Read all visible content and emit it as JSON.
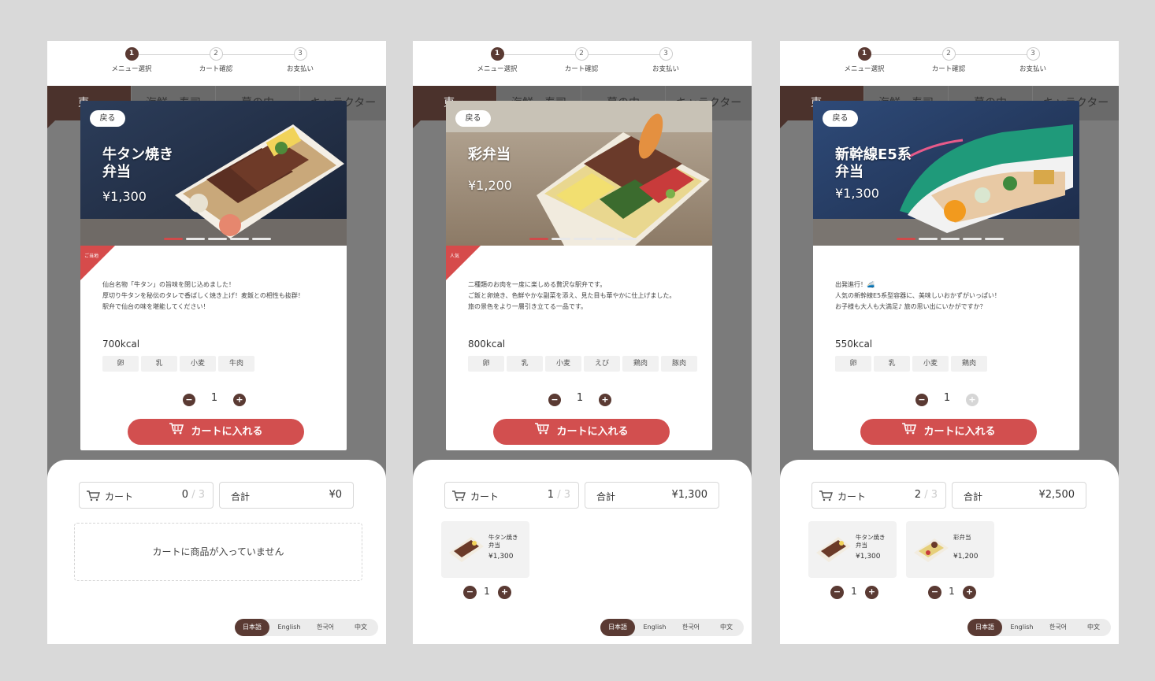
{
  "steps": [
    "メニュー選択",
    "カート確認",
    "お支払い"
  ],
  "step_numbers": [
    "1",
    "2",
    "3"
  ],
  "tabs": [
    "東…",
    "海鮮・寿司",
    "幕の内",
    "キャラクター"
  ],
  "back_label": "戻る",
  "cart_button_label": "カートに入れる",
  "cart_label": "カート",
  "total_label": "合計",
  "cart_max": "3",
  "empty_cart_message": "カートに商品が入っていません",
  "languages": [
    "日本語",
    "English",
    "한국어",
    "中文"
  ],
  "colors": {
    "brand_brown": "#5a3a33",
    "accent_red": "#d24f4f",
    "overlay_gray": "#7b7b7b"
  },
  "screens": [
    {
      "product": {
        "name_line1": "牛タン焼き",
        "name_line2": "弁当",
        "price": "¥1,300",
        "badge": "ご当地",
        "description": [
          "仙台名物「牛タン」の旨味を閉じ込めました！",
          "厚切り牛タンを秘伝のタレで香ばしく焼き上げ！麦飯との相性も抜群！",
          "駅弁で仙台の味を堪能してください！"
        ],
        "kcal": "700kcal",
        "allergens": [
          "卵",
          "乳",
          "小麦",
          "牛肉"
        ],
        "quantity": "1",
        "plus_enabled": true
      },
      "cart": {
        "count": "0",
        "total": "¥0",
        "items": []
      }
    },
    {
      "product": {
        "name_line1": "彩弁当",
        "name_line2": "",
        "price": "¥1,200",
        "badge": "人気",
        "description": [
          "二種類のお肉を一度に楽しめる贅沢な駅弁です。",
          "ご飯と卵焼き、色鮮やかな副菜を添え、見た目も華やかに仕上げました。",
          "旅の景色をより一層引き立てる一品です。"
        ],
        "kcal": "800kcal",
        "allergens": [
          "卵",
          "乳",
          "小麦",
          "えび",
          "鶏肉",
          "豚肉"
        ],
        "quantity": "1",
        "plus_enabled": true
      },
      "cart": {
        "count": "1",
        "total": "¥1,300",
        "items": [
          {
            "name_line1": "牛タン焼き",
            "name_line2": "弁当",
            "price": "¥1,300",
            "quantity": "1"
          }
        ]
      }
    },
    {
      "product": {
        "name_line1": "新幹線E5系",
        "name_line2": "弁当",
        "price": "¥1,300",
        "badge": "",
        "description": [
          "出発進行！🚄",
          "人気の新幹線E5系型容器に、美味しいおかずがいっぱい！",
          "お子様も大人も大満足♪ 旅の思い出にいかがですか？"
        ],
        "kcal": "550kcal",
        "allergens": [
          "卵",
          "乳",
          "小麦",
          "鶏肉"
        ],
        "quantity": "1",
        "plus_enabled": false
      },
      "cart": {
        "count": "2",
        "total": "¥2,500",
        "items": [
          {
            "name_line1": "牛タン焼き",
            "name_line2": "弁当",
            "price": "¥1,300",
            "quantity": "1"
          },
          {
            "name_line1": "彩弁当",
            "name_line2": "",
            "price": "¥1,200",
            "quantity": "1"
          }
        ]
      }
    }
  ]
}
